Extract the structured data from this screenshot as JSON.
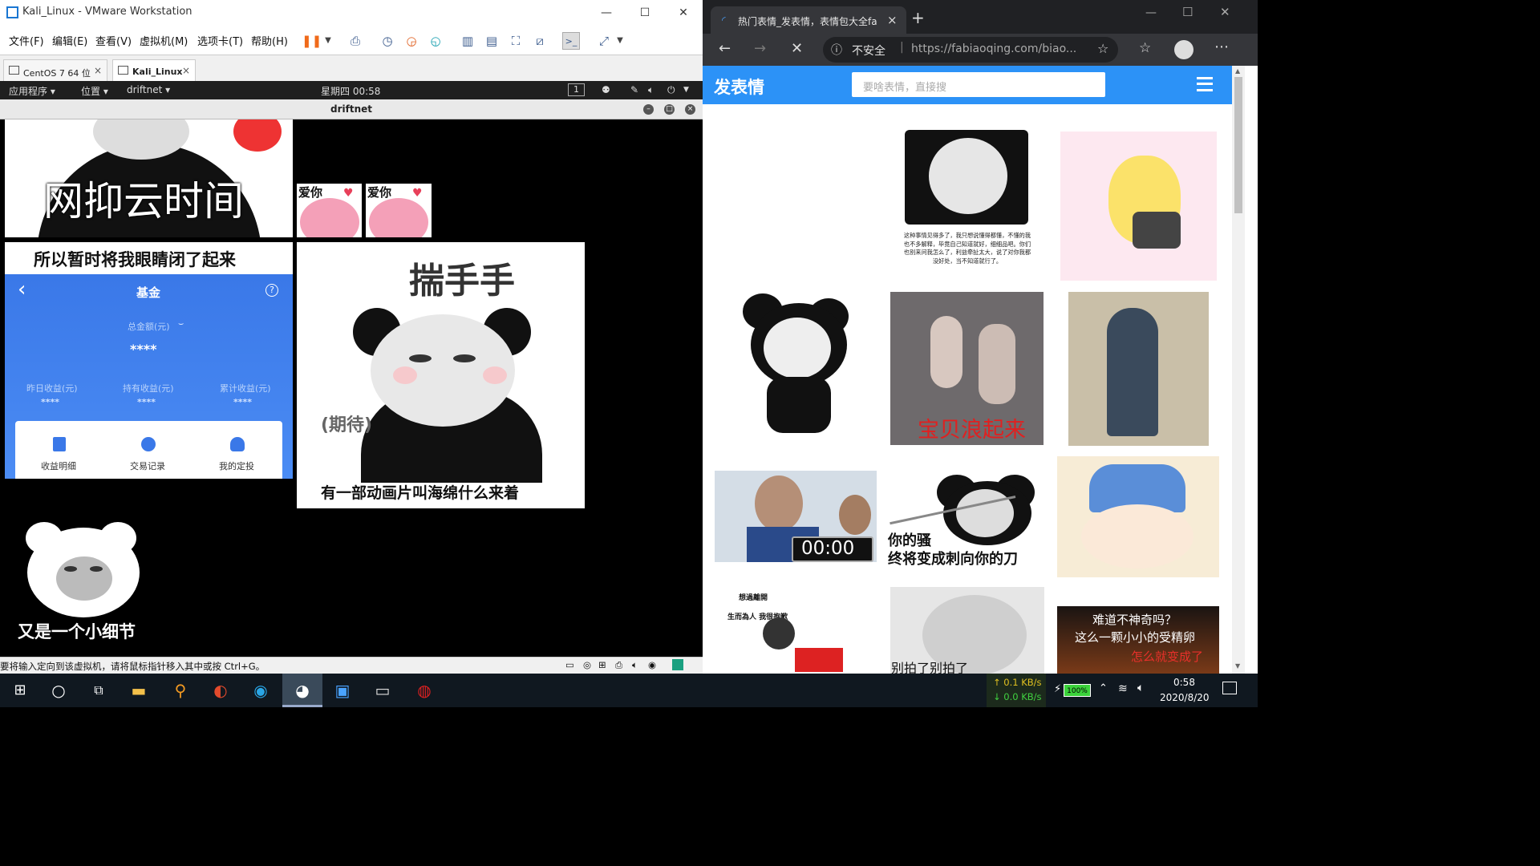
{
  "vmware": {
    "title": "Kali_Linux - VMware Workstation",
    "controls": {
      "minimize": "—",
      "maximize": "☐",
      "close": "✕"
    },
    "menu": [
      "文件(F)",
      "编辑(E)",
      "查看(V)",
      "虚拟机(M)",
      "选项卡(T)",
      "帮助(H)"
    ],
    "tabs": [
      {
        "label": "CentOS 7 64 位",
        "close": "×"
      },
      {
        "label": "Kali_Linux",
        "close": "×"
      }
    ],
    "status_text": "要将输入定向到该虚拟机，请将鼠标指针移入其中或按 Ctrl+G。"
  },
  "kali": {
    "panel": {
      "apps": "应用程序 ▾",
      "places": "位置 ▾",
      "current_app": "driftnet ▾",
      "clock": "星期四 00:58",
      "workspace": "1"
    },
    "window_title": "driftnet"
  },
  "driftnet_images": {
    "img1_caption": "网抑云时间",
    "love1": "爱你",
    "love2": "爱你",
    "img3_title": "所以暂时将我眼睛闭了起来",
    "fund": {
      "back": "‹",
      "title": "基金",
      "help": "?",
      "total_label": "总金额(元)",
      "total_value": "****",
      "stats": [
        {
          "label": "昨日收益(元)",
          "value": "****"
        },
        {
          "label": "持有收益(元)",
          "value": "****"
        },
        {
          "label": "累计收益(元)",
          "value": "****"
        }
      ],
      "actions": [
        "收益明细",
        "交易记录",
        "我的定投"
      ]
    },
    "img4_title": "揣手手",
    "img4_side": "(期待)",
    "img4_caption": "有一部动画片叫海绵什么来着",
    "img5_caption": "又是一个小细节"
  },
  "browser": {
    "tab_title": "热门表情_发表情，表情包大全fa",
    "tab_close": "×",
    "new_tab": "+",
    "not_secure": "不安全",
    "url": "https://fabiaoqing.com/biao...",
    "site": {
      "logo": "发表情",
      "search_placeholder": "要啥表情，直接搜",
      "menu_icon": "≡"
    },
    "grid_captions": {
      "panda_ok_text": "这种事情见得多了，我只想说懂得都懂，不懂的我也不多解释，毕竟自己知道就好，细细品吧。你们也别来问我怎么了，利益牵扯太大，说了对你我都没好处，当不知道就行了。",
      "dance": "宝贝浪起来",
      "timer": "00:00",
      "knife_1": "你的骚",
      "knife_2": "终将变成刺向你的刀",
      "dont_shoot": "别拍了别拍了",
      "sperm_1": "难道不神奇吗？",
      "sperm_2": "这么一颗小小的受精卵",
      "sperm_3": "怎么就变成了",
      "collage_1": "想過離開",
      "collage_2": "生而為人 我很抱歉"
    }
  },
  "taskbar": {
    "net_up": "↑ 0.1 KB/s",
    "net_down": "↓ 0.0 KB/s",
    "battery": "100%",
    "time": "0:58",
    "date": "2020/8/20"
  }
}
